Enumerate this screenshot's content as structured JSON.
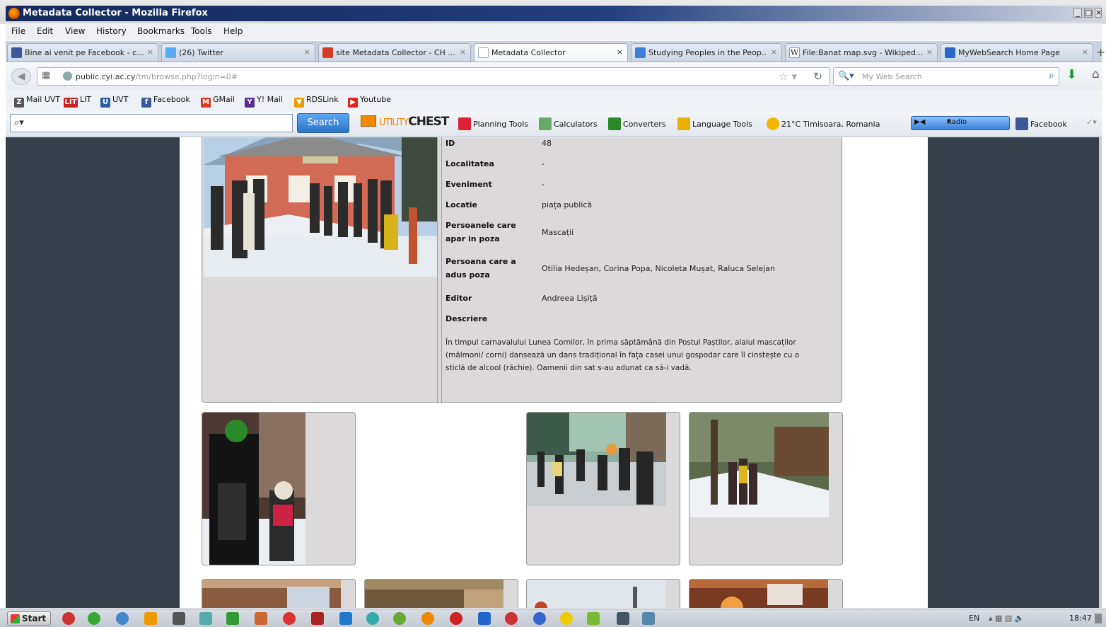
{
  "window": {
    "title": "Metadata Collector - Mozilla Firefox",
    "controls": [
      "_",
      "□",
      "×"
    ]
  },
  "menu": [
    "File",
    "Edit",
    "View",
    "History",
    "Bookmarks",
    "Tools",
    "Help"
  ],
  "tabs": [
    {
      "label": "Bine ai venit pe Facebook - c...",
      "icon_color": "#3b5998",
      "active": false
    },
    {
      "label": "(26) Twitter",
      "icon_color": "#55acee",
      "active": false
    },
    {
      "label": "site Metadata Collector - CH ...",
      "icon_color": "#d93a25",
      "active": false
    },
    {
      "label": "Metadata Collector",
      "icon_color": "#ffffff",
      "active": true
    },
    {
      "label": "Studying Peoples in the Peop...",
      "icon_color": "#3b7fd6",
      "active": false
    },
    {
      "label": "File:Banat map.svg - Wikiped...",
      "icon_color": "#ffffff",
      "active": false
    },
    {
      "label": "MyWebSearch Home Page",
      "icon_color": "#2a67c8",
      "active": false
    }
  ],
  "nav": {
    "url_host": "public.cyi.ac.cy",
    "url_path": "/tm/browse.php?login=0#",
    "url_prefix": "public.",
    "search_placeholder": "My Web Search"
  },
  "bookmarks": [
    {
      "label": "Mail UVT",
      "icon": "Z",
      "color": "#555555"
    },
    {
      "label": "LIT",
      "icon": "LIT",
      "color": "#cc2222"
    },
    {
      "label": "UVT",
      "icon": "U",
      "color": "#2a5fa8"
    },
    {
      "label": "Facebook",
      "icon": "f",
      "color": "#3b5998"
    },
    {
      "label": "GMail",
      "icon": "M",
      "color": "#d93a25"
    },
    {
      "label": "Y! Mail",
      "icon": "Y",
      "color": "#5c2d91"
    },
    {
      "label": "RDSLink",
      "icon": "▼",
      "color": "#e8a000"
    },
    {
      "label": "Youtube",
      "icon": "▶",
      "color": "#e62117"
    }
  ],
  "toolbar": {
    "search_button": "Search",
    "chest_brand_a": "UTILITY",
    "chest_brand_b": "CHEST",
    "items": [
      {
        "label": "Planning Tools",
        "color": "#d23"
      },
      {
        "label": "Calculators",
        "color": "#6a6"
      },
      {
        "label": "Converters",
        "color": "#2a8a2a"
      },
      {
        "label": "Language Tools",
        "color": "#e8b000"
      },
      {
        "label": "21°C Timisoara, Romania",
        "color": "#f2b600"
      }
    ],
    "radio_label": "Radio",
    "facebook_label": "Facebook"
  },
  "detail": {
    "fields": [
      {
        "label": "ID",
        "value": "48"
      },
      {
        "label": "Localitatea",
        "value": "-"
      },
      {
        "label": "Eveniment",
        "value": "-"
      },
      {
        "label": "Locatie",
        "value": "piața publică"
      },
      {
        "label": "Persoanele care apar in poza",
        "value": "Mascații"
      },
      {
        "label": "Persoana care a adus poza",
        "value": "Otilia Hedeșan, Corina Popa, Nicoleta Mușat, Raluca Selejan"
      },
      {
        "label": "Editor",
        "value": "Andreea Lișiță"
      },
      {
        "label": "Descriere",
        "value": ""
      }
    ],
    "description": "În timpul carnavalului Lunea Cornilor, în prima săptămână din Postul Paștilor, alaiul mascaților (mălmoni/ corni) dansează un dans tradițional în fața casei unui gospodar care îl cinstește cu o sticlă de alcool (răchie). Oamenii din sat s-au adunat ca să-i vadă."
  },
  "taskbar": {
    "start": "Start",
    "lang": "EN",
    "clock": "18:47",
    "icons": [
      "#c33",
      "#3a3",
      "#48c",
      "#e90",
      "#555",
      "#5aa",
      "#393",
      "#c63",
      "#d33",
      "#a22",
      "#27c",
      "#3aa",
      "#6a3",
      "#e80",
      "#c22",
      "#26c",
      "#c33",
      "#36c",
      "#ec0",
      "#7b3",
      "#456",
      "#58a"
    ]
  }
}
